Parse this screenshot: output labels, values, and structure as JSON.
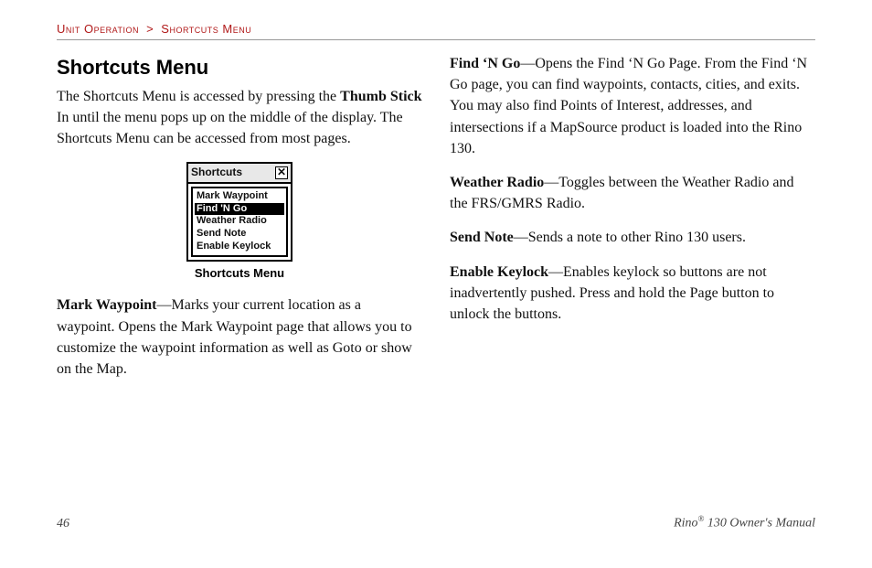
{
  "breadcrumb": {
    "section": "Unit Operation",
    "sep": ">",
    "page": "Shortcuts Menu"
  },
  "left": {
    "title": "Shortcuts Menu",
    "intro_1": "The Shortcuts Menu is accessed by pressing the ",
    "intro_b1": "Thumb Stick",
    "intro_2": " In until the menu pops up on the middle of the display. The Shortcuts Menu can be accessed from most pages.",
    "figure": {
      "header": "Shortcuts",
      "items": [
        "Mark Waypoint",
        "Find 'N Go",
        "Weather Radio",
        "Send Note",
        "Enable Keylock"
      ],
      "selected_index": 1,
      "caption": "Shortcuts Menu"
    },
    "mark_b": "Mark Waypoint",
    "mark_text": "—Marks your current location as a waypoint. Opens the Mark Waypoint page that allows you to customize the waypoint information as well as Goto or show on the Map."
  },
  "right": {
    "find_b": "Find ‘N Go",
    "find_text": "—Opens the Find ‘N Go Page. From the Find ‘N Go page, you can find waypoints, contacts, cities, and exits. You may also find Points of Interest, addresses, and intersections if a MapSource product is loaded into the Rino 130.",
    "weather_b": "Weather Radio",
    "weather_text": "—Toggles between the Weather Radio and the FRS/GMRS Radio.",
    "send_b": "Send Note",
    "send_text": "—Sends a note to other Rino 130 users.",
    "keylock_b": "Enable Keylock",
    "keylock_text": "—Enables keylock so buttons are not inadvertently pushed. Press and hold the Page button to unlock the buttons."
  },
  "footer": {
    "page": "46",
    "manual_1": "Rino",
    "manual_sup": "®",
    "manual_2": " 130 Owner's Manual"
  }
}
